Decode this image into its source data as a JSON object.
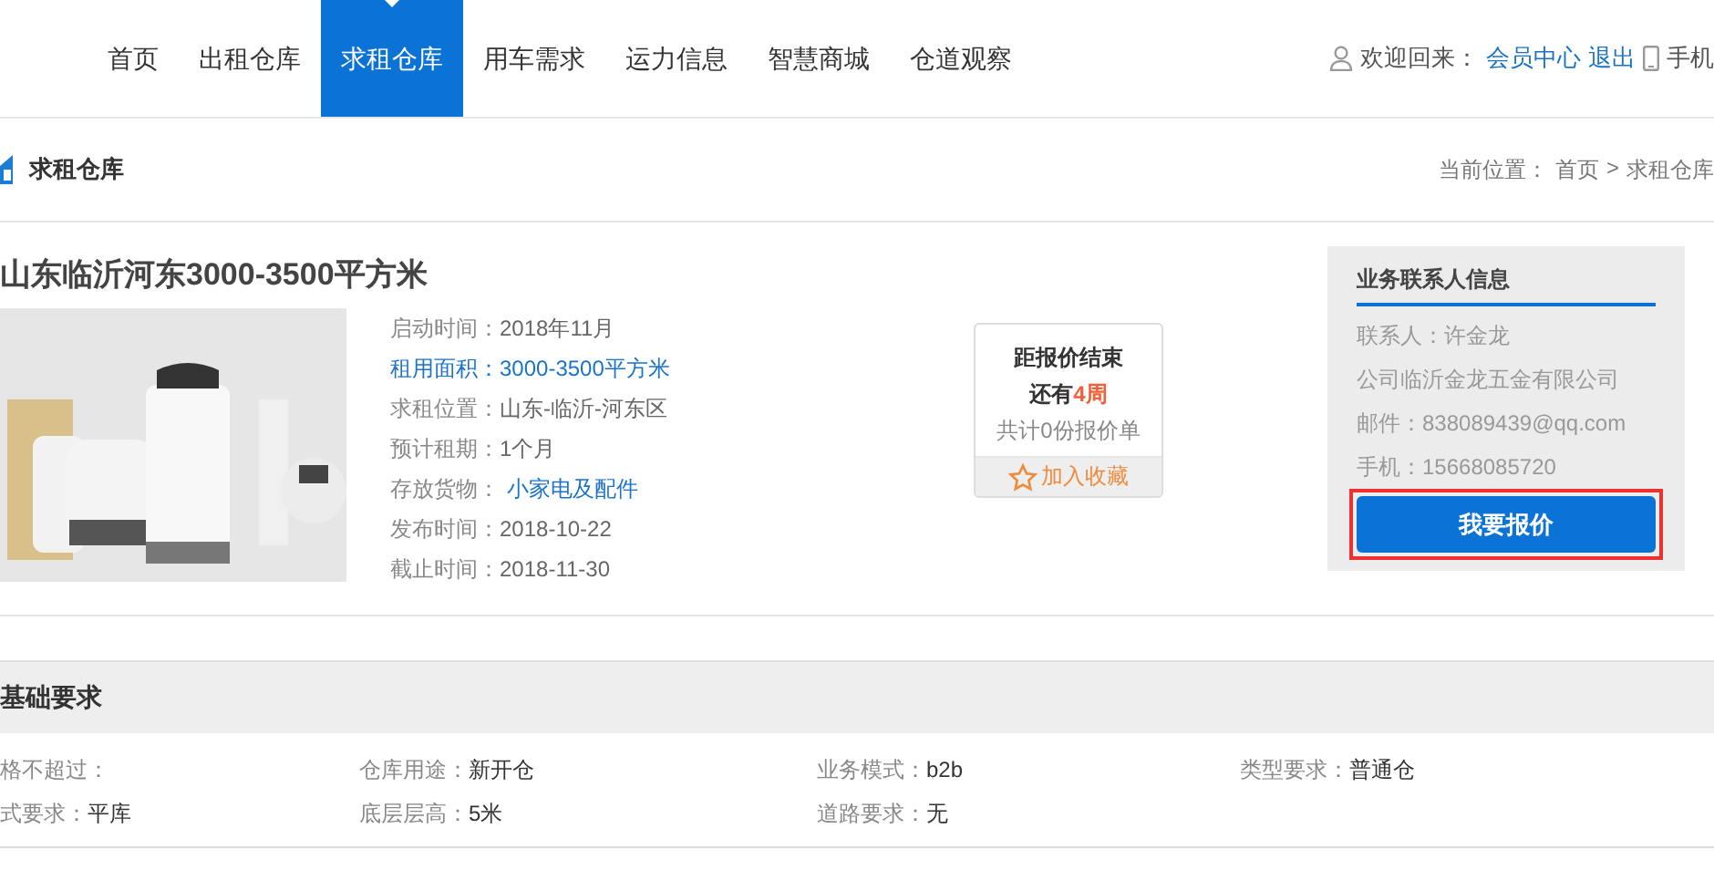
{
  "nav": {
    "items": [
      {
        "label": "首页",
        "selected": false
      },
      {
        "label": "出租仓库",
        "selected": false
      },
      {
        "label": "求租仓库",
        "selected": true
      },
      {
        "label": "用车需求",
        "selected": false
      },
      {
        "label": "运力信息",
        "selected": false
      },
      {
        "label": "智慧商城",
        "selected": false
      },
      {
        "label": "仓道观察",
        "selected": false
      }
    ],
    "welcome": "欢迎回来：",
    "member_link": "会员中心",
    "logout_link": "退出",
    "mobile": "手机"
  },
  "section_bar": {
    "title": "求租仓库",
    "location_label": "当前位置：",
    "crumbs": [
      "首页",
      "求租仓库"
    ],
    "separator": ">"
  },
  "listing": {
    "title": "山东临沂河东3000-3500平方米",
    "fields": [
      {
        "label": "启动时间：",
        "value": "2018年11月",
        "kind": "plain"
      },
      {
        "label": "租用面积：",
        "value": "3000-3500平方米",
        "kind": "link"
      },
      {
        "label": "求租位置：",
        "value": "山东-临沂-河东区",
        "kind": "plain"
      },
      {
        "label": "预计租期：",
        "value": "1个月",
        "kind": "plain"
      },
      {
        "label": "存放货物：",
        "value": "小家电及配件",
        "kind": "link-value"
      },
      {
        "label": "发布时间：",
        "value": "2018-10-22",
        "kind": "plain"
      },
      {
        "label": "截止时间：",
        "value": "2018-11-30",
        "kind": "plain"
      }
    ],
    "countdown": {
      "heading": "距报价结束",
      "remain_prefix": "还有",
      "remain": "4周",
      "count": "共计0份报价单",
      "favorite": "加入收藏"
    },
    "contact": {
      "title": "业务联系人信息",
      "lines": [
        "联系人：许金龙",
        "公司临沂金龙五金有限公司",
        "邮件：838089439@qq.com",
        "手机：15668085720"
      ],
      "button": "我要报价"
    }
  },
  "requirements": {
    "title": "基础要求",
    "rows": [
      [
        {
          "label": "格不超过："
        },
        {
          "label": "仓库用途：",
          "value": "新开仓"
        },
        {
          "label": "业务模式：",
          "value": "b2b"
        },
        {
          "label": "类型要求：",
          "value": "普通仓"
        }
      ],
      [
        {
          "label": "式要求：",
          "value": "平库"
        },
        {
          "label": "底层层高：",
          "value": "5米"
        },
        {
          "label": "道路要求：",
          "value": "无"
        }
      ]
    ]
  }
}
